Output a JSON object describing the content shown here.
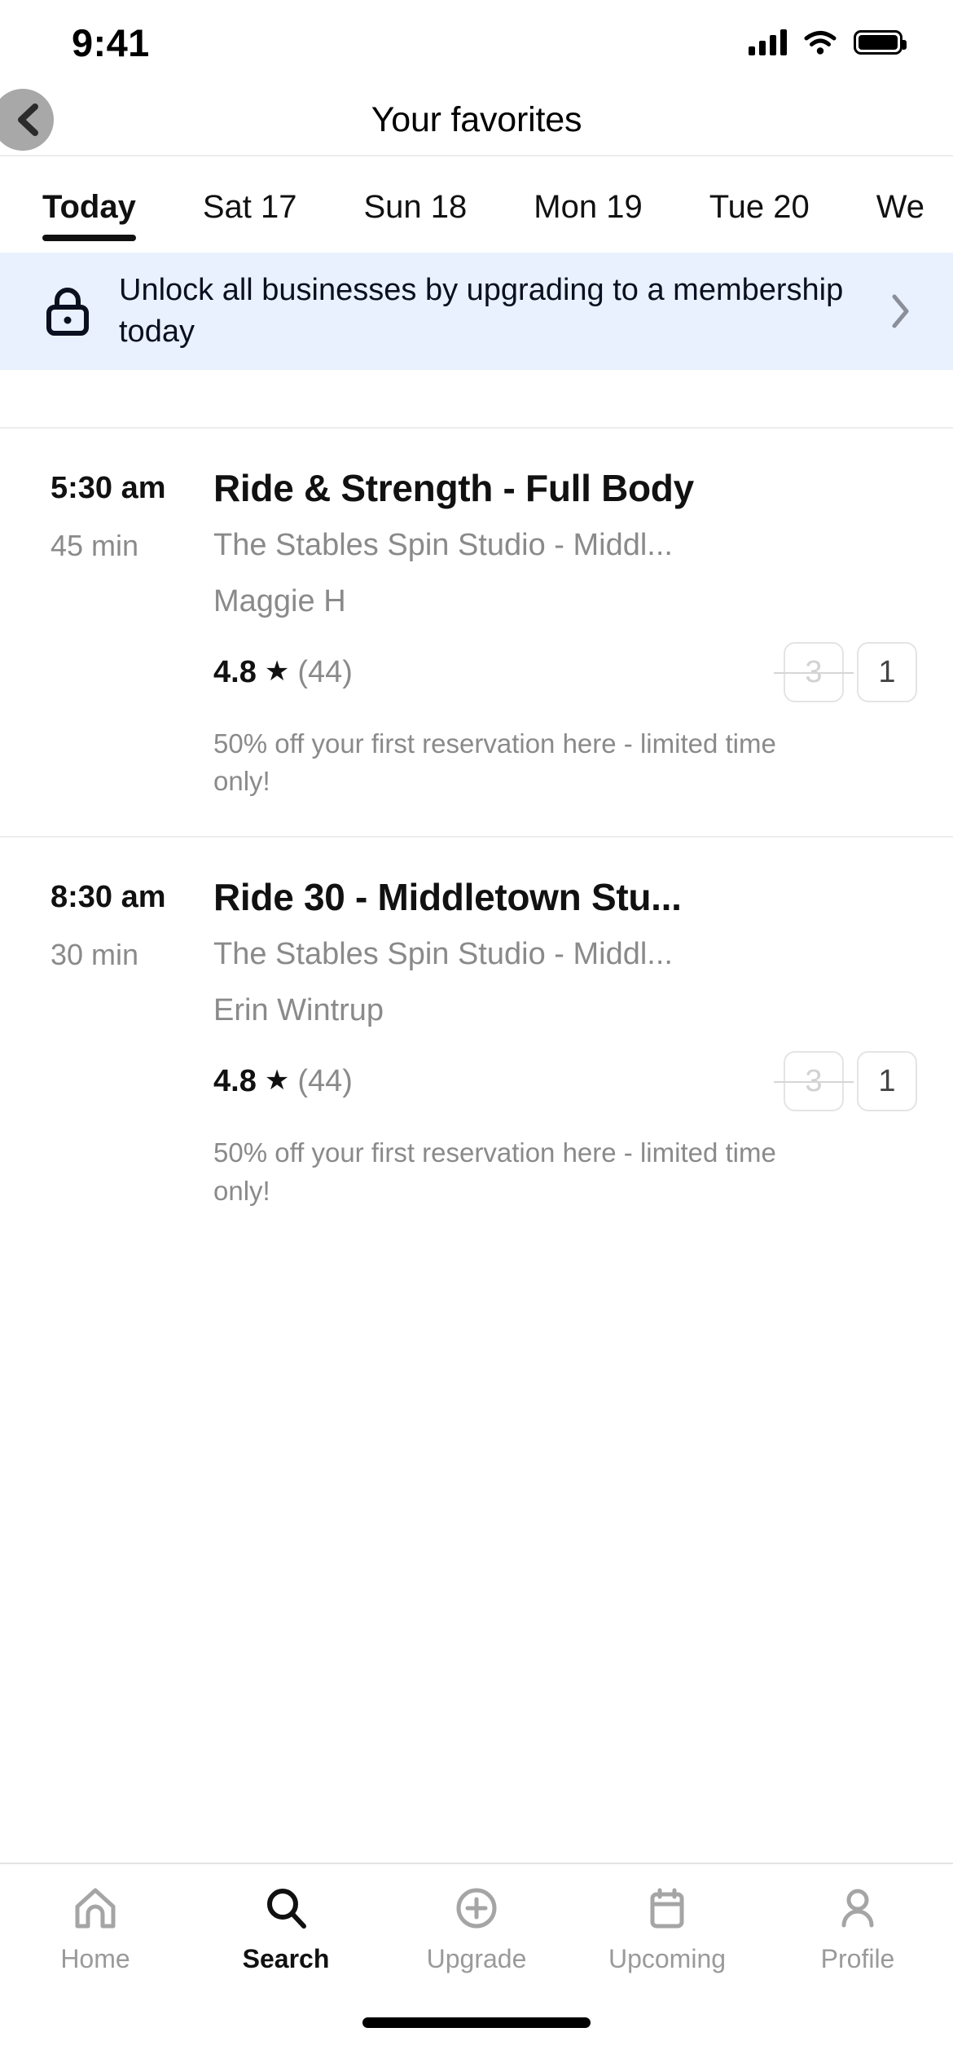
{
  "status_bar": {
    "time": "9:41",
    "cellular_icon": "signal-bars-icon",
    "wifi_icon": "wifi-icon",
    "battery_icon": "battery-full-icon"
  },
  "header": {
    "title": "Your favorites",
    "back_icon": "chevron-left-icon"
  },
  "date_tabs": {
    "selected_index": 0,
    "items": [
      {
        "label": "Today"
      },
      {
        "label": "Sat 17"
      },
      {
        "label": "Sun 18"
      },
      {
        "label": "Mon 19"
      },
      {
        "label": "Tue 20"
      },
      {
        "label": "We"
      }
    ]
  },
  "banner": {
    "icon": "lock-icon",
    "text": "Unlock all businesses by upgrading to a membership today",
    "chevron_icon": "chevron-right-icon",
    "background_color": "#e8f1fd",
    "text_color": "#0b1020"
  },
  "classes": [
    {
      "time": "5:30 am",
      "duration": "45 min",
      "title": "Ride & Strength - Full Body",
      "venue": "The Stables Spin Studio - Middl...",
      "instructor": "Maggie H",
      "rating": "4.8",
      "star_icon": "star-filled-icon",
      "review_count": "(44)",
      "credits_original": "3",
      "credits_discounted": "1",
      "promo": "50% off your first reservation here - limited time only!"
    },
    {
      "time": "8:30 am",
      "duration": "30 min",
      "title": "Ride 30 - Middletown Stu...",
      "venue": "The Stables Spin Studio - Middl...",
      "instructor": "Erin Wintrup",
      "rating": "4.8",
      "star_icon": "star-filled-icon",
      "review_count": "(44)",
      "credits_original": "3",
      "credits_discounted": "1",
      "promo": "50% off your first reservation here - limited time only!"
    }
  ],
  "tab_bar": {
    "selected_index": 1,
    "items": [
      {
        "label": "Home",
        "icon": "home-icon"
      },
      {
        "label": "Search",
        "icon": "search-icon"
      },
      {
        "label": "Upgrade",
        "icon": "plus-circle-icon"
      },
      {
        "label": "Upcoming",
        "icon": "calendar-icon"
      },
      {
        "label": "Profile",
        "icon": "person-icon"
      }
    ]
  }
}
